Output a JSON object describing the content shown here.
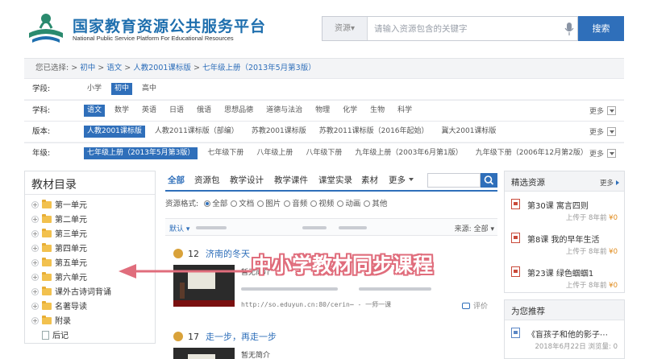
{
  "header": {
    "logo_cn": "国家教育资源公共服务平台",
    "logo_en": "National Public Service Platform For Educational Resources",
    "search_scope": "资源",
    "search_placeholder": "请输入资源包含的关键字",
    "search_button": "搜索"
  },
  "breadcrumb": {
    "prefix": "您已选择:",
    "items": [
      "初中",
      "语文",
      "人教2001课标版",
      "七年级上册（2013年5月第3版）"
    ],
    "sep": " > "
  },
  "filters": {
    "more_label": "更多",
    "rows": [
      {
        "label": "学段:",
        "options": [
          "小学",
          "初中",
          "高中"
        ],
        "selected": 1
      },
      {
        "label": "学科:",
        "options": [
          "语文",
          "数学",
          "英语",
          "日语",
          "俄语",
          "思想品德",
          "道德与法治",
          "物理",
          "化学",
          "生物",
          "科学"
        ],
        "selected": 0
      },
      {
        "label": "版本:",
        "options": [
          "人教2001课标版",
          "人教2011课标版（部编）",
          "苏教2001课标版",
          "苏教2011课标版（2016年起始）",
          "冀大2001课标版"
        ],
        "selected": 0
      },
      {
        "label": "年级:",
        "options": [
          "七年级上册（2013年5月第3版）",
          "七年级下册",
          "八年级上册",
          "八年级下册",
          "九年级上册（2003年6月第1版）",
          "九年级下册（2006年12月第2版）"
        ],
        "selected": 0
      }
    ]
  },
  "catalog": {
    "title": "教材目录",
    "items": [
      {
        "label": "第一单元",
        "type": "folder"
      },
      {
        "label": "第二单元",
        "type": "folder"
      },
      {
        "label": "第三单元",
        "type": "folder"
      },
      {
        "label": "第四单元",
        "type": "folder"
      },
      {
        "label": "第五单元",
        "type": "folder"
      },
      {
        "label": "第六单元",
        "type": "folder"
      },
      {
        "label": "课外古诗词背诵",
        "type": "folder"
      },
      {
        "label": "名著导读",
        "type": "folder"
      },
      {
        "label": "附录",
        "type": "folder"
      },
      {
        "label": "后记",
        "type": "doc"
      }
    ]
  },
  "tabs": {
    "items": [
      "全部",
      "资源包",
      "教学设计",
      "教学课件",
      "课堂实录",
      "素材"
    ],
    "active": 0,
    "more": "更多"
  },
  "format_row": {
    "label": "资源格式:",
    "options": [
      "全部",
      "文档",
      "图片",
      "音频",
      "视频",
      "动画",
      "其他"
    ],
    "selected": 0
  },
  "sort_row": {
    "sort_label": "默认",
    "source_label": "来源:",
    "source_value": "全部"
  },
  "results": [
    {
      "num": "12",
      "title": "济南的冬天",
      "desc": "暂无简介",
      "url": "http://so.eduyun.cn:80/cerin⋯ - 一师一课",
      "eval": "评价"
    },
    {
      "num": "17",
      "title": "走一步，再走一步",
      "desc": "暂无简介"
    }
  ],
  "featured": {
    "title": "精选资源",
    "more": "更多",
    "items": [
      {
        "name": "第30课 寓言四则",
        "meta": "上传于 8年前",
        "price": "¥0"
      },
      {
        "name": "第8课 我的早年生活",
        "meta": "上传于 8年前",
        "price": "¥0"
      },
      {
        "name": "第23课 绿色蝈蝈1",
        "meta": "上传于 8年前",
        "price": "¥0"
      }
    ]
  },
  "recommend": {
    "title": "为您推荐",
    "items": [
      {
        "name": "《盲孩子和他的影子⋯",
        "meta": "2018年6月22日 浏览量:",
        "count": "0"
      }
    ]
  },
  "overlay": {
    "text": "中小学教材同步课程"
  },
  "colors": {
    "accent": "#2f6fba",
    "overlay_pink": "#e06d7c",
    "price": "#e08a1a"
  }
}
